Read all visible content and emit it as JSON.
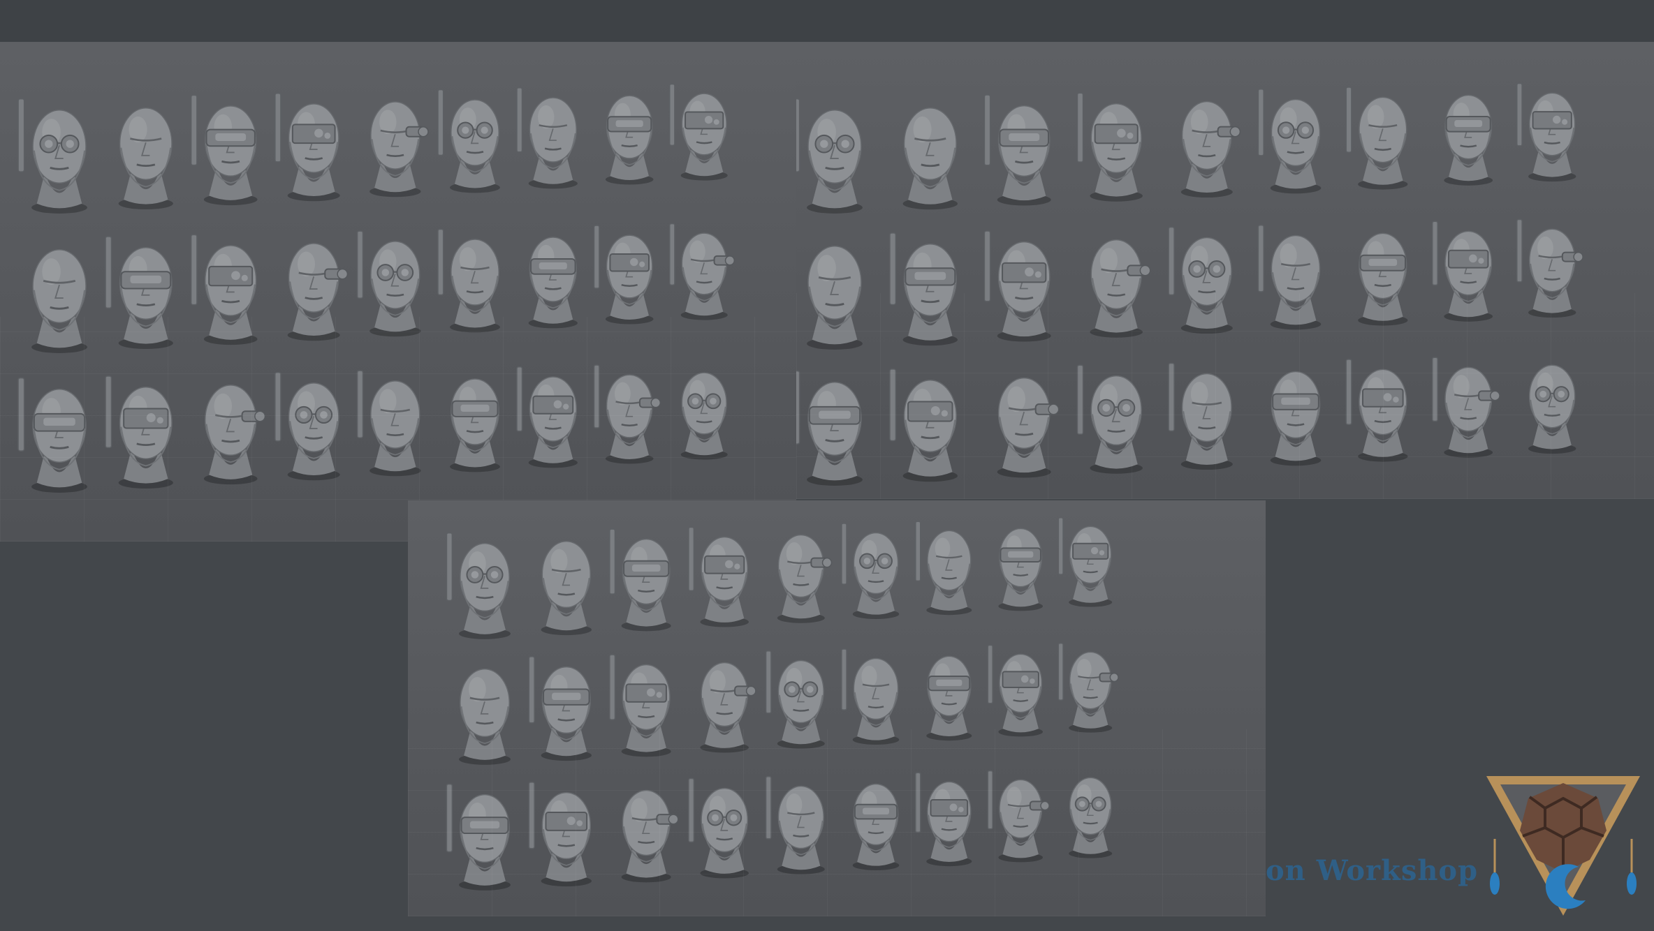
{
  "image": {
    "description_colors": {
      "background": "#43474b",
      "render_background": "#5a5c60",
      "sculpt": "#8a8d91",
      "brand_text": "#2f5f86",
      "logo_gold": "#b8915a",
      "logo_brown": "#6b4a3a",
      "logo_blue": "#2b7fc0"
    },
    "panels": [
      {
        "id": "left",
        "rows": 3,
        "cols": 9
      },
      {
        "id": "right",
        "rows": 3,
        "cols": 9
      },
      {
        "id": "bottom",
        "rows": 3,
        "cols": 9
      }
    ]
  },
  "branding": {
    "text": "on Workshop"
  }
}
